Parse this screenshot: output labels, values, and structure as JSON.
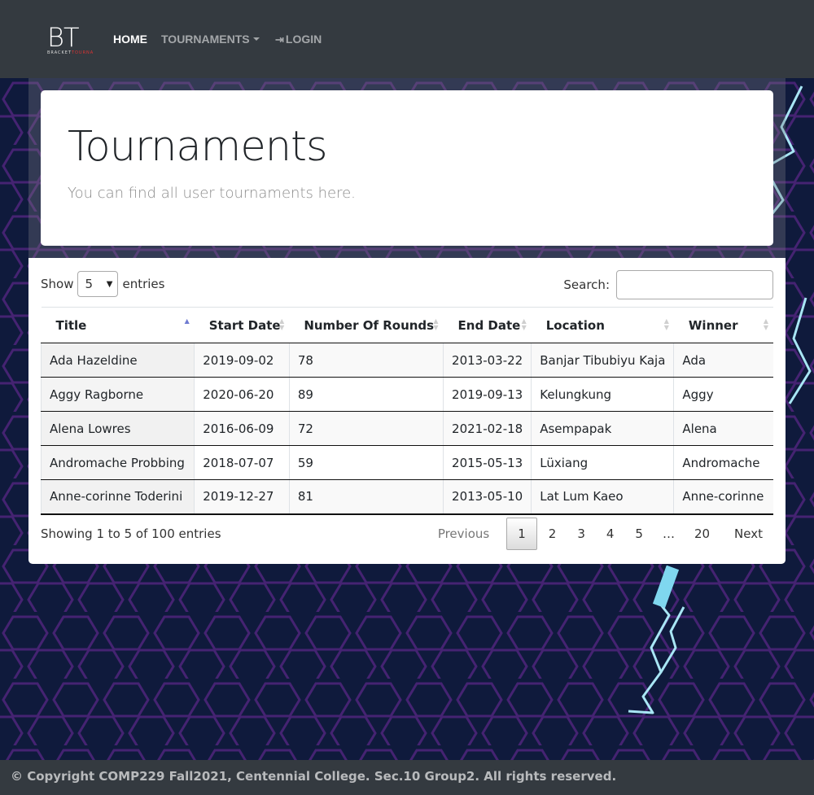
{
  "brand": {
    "logo_text": "BT",
    "logo_sub_a": "BRACKET",
    "logo_sub_b": "TOURNA"
  },
  "nav": {
    "home": "HOME",
    "tournaments": "TOURNAMENTS",
    "login": "LOGIN"
  },
  "page": {
    "title": "Tournaments",
    "lead": "You can find all user tournaments here."
  },
  "table": {
    "length_prefix": "Show",
    "length_value": "5",
    "length_suffix": "entries",
    "search_label": "Search:",
    "search_value": "",
    "columns": [
      "Title",
      "Start Date",
      "Number Of Rounds",
      "End Date",
      "Location",
      "Winner"
    ],
    "sorted_column": "Title",
    "sort_direction": "ascending",
    "rows": [
      [
        "Ada Hazeldine",
        "2019-09-02",
        "78",
        "2013-03-22",
        "Banjar Tibubiyu Kaja",
        "Ada"
      ],
      [
        "Aggy Ragborne",
        "2020-06-20",
        "89",
        "2019-09-13",
        "Kelungkung",
        "Aggy"
      ],
      [
        "Alena Lowres",
        "2016-06-09",
        "72",
        "2021-02-18",
        "Asempapak",
        "Alena"
      ],
      [
        "Andromache Probbing",
        "2018-07-07",
        "59",
        "2015-05-13",
        "Lüxiang",
        "Andromache"
      ],
      [
        "Anne-corinne Toderini",
        "2019-12-27",
        "81",
        "2013-05-10",
        "Lat Lum Kaeo",
        "Anne-corinne"
      ]
    ],
    "info": "Showing 1 to 5 of 100 entries",
    "pagination": {
      "previous": "Previous",
      "pages": [
        "1",
        "2",
        "3",
        "4",
        "5"
      ],
      "ellipsis": "…",
      "last": "20",
      "next": "Next",
      "current": "1"
    }
  },
  "footer": {
    "text": "© Copyright COMP229 Fall2021, Centennial College. Sec.10 Group2. All rights reserved."
  },
  "colors": {
    "navbar": "#343a40",
    "background": "#0f1a3c",
    "hex_pattern": "#5a2a8a",
    "lightning": "#9fe3f5"
  }
}
